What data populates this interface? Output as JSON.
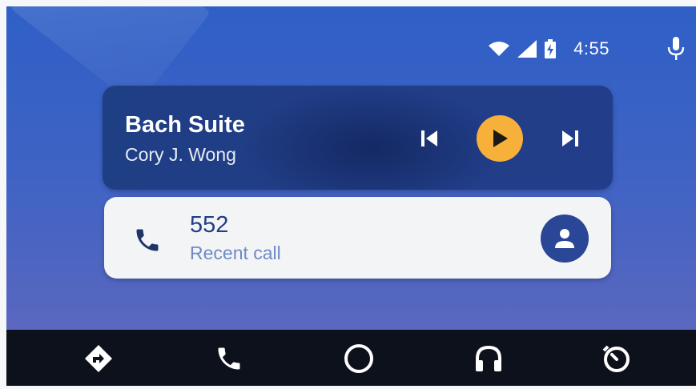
{
  "status": {
    "time": "4:55",
    "icons": [
      "wifi-icon",
      "cell-signal-icon",
      "battery-charging-icon",
      "microphone-icon"
    ]
  },
  "music": {
    "title": "Bach Suite",
    "artist": "Cory J. Wong",
    "controls": [
      "skip-previous-icon",
      "play-icon",
      "skip-next-icon"
    ],
    "play_color": "#f7b03a"
  },
  "call": {
    "number": "552",
    "subtitle": "Recent call",
    "icons": [
      "phone-icon",
      "contact-avatar-icon"
    ]
  },
  "nav": {
    "items": [
      "navigation-icon",
      "phone-icon",
      "home-icon",
      "audio-icon",
      "overview-icon"
    ]
  },
  "colors": {
    "background": "#3a63c6",
    "music_card": "#213d86",
    "call_card": "#f3f4f5",
    "accent": "#f7b03a",
    "navbar": "#0d111c"
  }
}
